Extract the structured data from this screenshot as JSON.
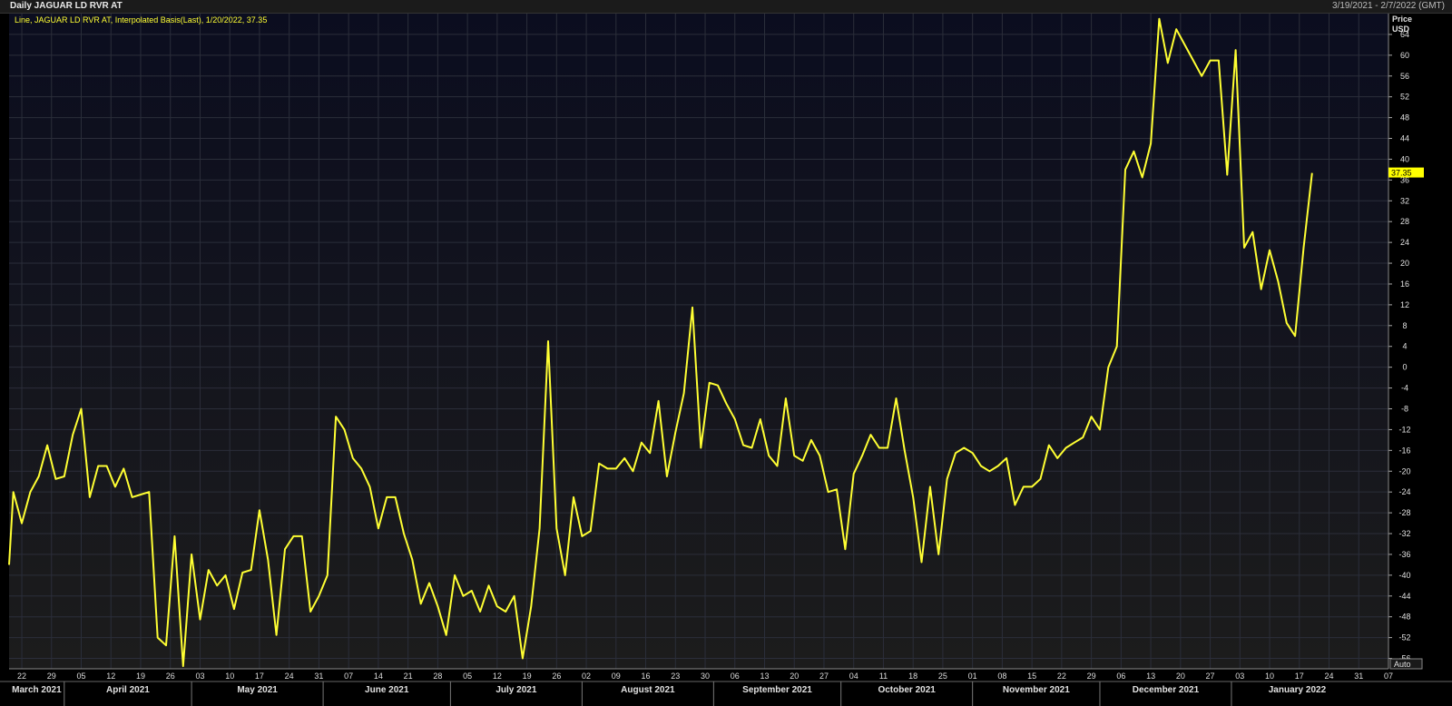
{
  "window": {
    "title": "Daily JAGUAR LD RVR AT",
    "date_range": "3/19/2021 - 2/7/2022 (GMT)",
    "legend": "Line, JAGUAR LD RVR AT, Interpolated Basis(Last),  1/20/2022, 37.35",
    "axis_unit_top": "Price",
    "axis_unit_bottom": "USD",
    "auto_button": "Auto",
    "last_value_label": "37.35"
  },
  "colors": {
    "background": "#0b0d1a",
    "line": "#ffff33",
    "grid": "#2b2e3a",
    "label_bg": "#ffff00"
  },
  "chart_data": {
    "type": "line",
    "title": "Daily JAGUAR LD RVR AT",
    "ylabel": "Price USD",
    "ylim": [
      -58,
      68
    ],
    "yticks": [
      -56,
      -52,
      -48,
      -44,
      -40,
      -36,
      -32,
      -28,
      -24,
      -20,
      -16,
      -12,
      -8,
      -4,
      0,
      4,
      8,
      12,
      16,
      20,
      24,
      28,
      32,
      36,
      40,
      44,
      48,
      52,
      56,
      60,
      64
    ],
    "xlim": [
      "2021-03-19",
      "2022-02-07"
    ],
    "xticks": [
      {
        "date": "2021-03-22",
        "label": "22"
      },
      {
        "date": "2021-03-29",
        "label": "29"
      },
      {
        "date": "2021-04-05",
        "label": "05"
      },
      {
        "date": "2021-04-12",
        "label": "12"
      },
      {
        "date": "2021-04-19",
        "label": "19"
      },
      {
        "date": "2021-04-26",
        "label": "26"
      },
      {
        "date": "2021-05-03",
        "label": "03"
      },
      {
        "date": "2021-05-10",
        "label": "10"
      },
      {
        "date": "2021-05-17",
        "label": "17"
      },
      {
        "date": "2021-05-24",
        "label": "24"
      },
      {
        "date": "2021-05-31",
        "label": "31"
      },
      {
        "date": "2021-06-07",
        "label": "07"
      },
      {
        "date": "2021-06-14",
        "label": "14"
      },
      {
        "date": "2021-06-21",
        "label": "21"
      },
      {
        "date": "2021-06-28",
        "label": "28"
      },
      {
        "date": "2021-07-05",
        "label": "05"
      },
      {
        "date": "2021-07-12",
        "label": "12"
      },
      {
        "date": "2021-07-19",
        "label": "19"
      },
      {
        "date": "2021-07-26",
        "label": "26"
      },
      {
        "date": "2021-08-02",
        "label": "02"
      },
      {
        "date": "2021-08-09",
        "label": "09"
      },
      {
        "date": "2021-08-16",
        "label": "16"
      },
      {
        "date": "2021-08-23",
        "label": "23"
      },
      {
        "date": "2021-08-30",
        "label": "30"
      },
      {
        "date": "2021-09-06",
        "label": "06"
      },
      {
        "date": "2021-09-13",
        "label": "13"
      },
      {
        "date": "2021-09-20",
        "label": "20"
      },
      {
        "date": "2021-09-27",
        "label": "27"
      },
      {
        "date": "2021-10-04",
        "label": "04"
      },
      {
        "date": "2021-10-11",
        "label": "11"
      },
      {
        "date": "2021-10-18",
        "label": "18"
      },
      {
        "date": "2021-10-25",
        "label": "25"
      },
      {
        "date": "2021-11-01",
        "label": "01"
      },
      {
        "date": "2021-11-08",
        "label": "08"
      },
      {
        "date": "2021-11-15",
        "label": "15"
      },
      {
        "date": "2021-11-22",
        "label": "22"
      },
      {
        "date": "2021-11-29",
        "label": "29"
      },
      {
        "date": "2021-12-06",
        "label": "06"
      },
      {
        "date": "2021-12-13",
        "label": "13"
      },
      {
        "date": "2021-12-20",
        "label": "20"
      },
      {
        "date": "2021-12-27",
        "label": "27"
      },
      {
        "date": "2022-01-03",
        "label": "03"
      },
      {
        "date": "2022-01-10",
        "label": "10"
      },
      {
        "date": "2022-01-17",
        "label": "17"
      },
      {
        "date": "2022-01-24",
        "label": "24"
      },
      {
        "date": "2022-01-31",
        "label": "31"
      },
      {
        "date": "2022-02-07",
        "label": "07"
      }
    ],
    "months": [
      {
        "label": "March 2021",
        "start": "2021-03-19",
        "end": "2021-04-01"
      },
      {
        "label": "April 2021",
        "start": "2021-04-01",
        "end": "2021-05-01"
      },
      {
        "label": "May 2021",
        "start": "2021-05-01",
        "end": "2021-06-01"
      },
      {
        "label": "June 2021",
        "start": "2021-06-01",
        "end": "2021-07-01"
      },
      {
        "label": "July 2021",
        "start": "2021-07-01",
        "end": "2021-08-01"
      },
      {
        "label": "August 2021",
        "start": "2021-08-01",
        "end": "2021-09-01"
      },
      {
        "label": "September 2021",
        "start": "2021-09-01",
        "end": "2021-10-01"
      },
      {
        "label": "October 2021",
        "start": "2021-10-01",
        "end": "2021-11-01"
      },
      {
        "label": "November 2021",
        "start": "2021-11-01",
        "end": "2021-12-01"
      },
      {
        "label": "December 2021",
        "start": "2021-12-01",
        "end": "2022-01-01"
      },
      {
        "label": "January 2022",
        "start": "2022-01-01",
        "end": "2022-02-01"
      }
    ],
    "series": [
      {
        "name": "JAGUAR LD RVR AT",
        "points": [
          [
            "2021-03-19",
            -38
          ],
          [
            "2021-03-20",
            -24
          ],
          [
            "2021-03-22",
            -30
          ],
          [
            "2021-03-24",
            -24
          ],
          [
            "2021-03-26",
            -21
          ],
          [
            "2021-03-28",
            -15
          ],
          [
            "2021-03-30",
            -21.5
          ],
          [
            "2021-04-01",
            -21
          ],
          [
            "2021-04-03",
            -13
          ],
          [
            "2021-04-05",
            -8
          ],
          [
            "2021-04-07",
            -25
          ],
          [
            "2021-04-09",
            -19
          ],
          [
            "2021-04-11",
            -19
          ],
          [
            "2021-04-13",
            -23
          ],
          [
            "2021-04-15",
            -19.5
          ],
          [
            "2021-04-17",
            -25
          ],
          [
            "2021-04-19",
            -24.5
          ],
          [
            "2021-04-21",
            -24
          ],
          [
            "2021-04-23",
            -52
          ],
          [
            "2021-04-25",
            -53.5
          ],
          [
            "2021-04-27",
            -32.5
          ],
          [
            "2021-04-29",
            -57.5
          ],
          [
            "2021-05-01",
            -36
          ],
          [
            "2021-05-03",
            -48.5
          ],
          [
            "2021-05-05",
            -39
          ],
          [
            "2021-05-07",
            -42
          ],
          [
            "2021-05-09",
            -40
          ],
          [
            "2021-05-11",
            -46.5
          ],
          [
            "2021-05-13",
            -39.5
          ],
          [
            "2021-05-15",
            -39
          ],
          [
            "2021-05-17",
            -27.5
          ],
          [
            "2021-05-19",
            -37
          ],
          [
            "2021-05-21",
            -51.5
          ],
          [
            "2021-05-23",
            -35
          ],
          [
            "2021-05-25",
            -32.5
          ],
          [
            "2021-05-27",
            -32.5
          ],
          [
            "2021-05-29",
            -47
          ],
          [
            "2021-05-31",
            -44
          ],
          [
            "2021-06-02",
            -40
          ],
          [
            "2021-06-04",
            -9.5
          ],
          [
            "2021-06-06",
            -12
          ],
          [
            "2021-06-08",
            -17.5
          ],
          [
            "2021-06-10",
            -19.5
          ],
          [
            "2021-06-12",
            -23
          ],
          [
            "2021-06-14",
            -31
          ],
          [
            "2021-06-16",
            -25
          ],
          [
            "2021-06-18",
            -25
          ],
          [
            "2021-06-20",
            -32
          ],
          [
            "2021-06-22",
            -37
          ],
          [
            "2021-06-24",
            -45.5
          ],
          [
            "2021-06-26",
            -41.5
          ],
          [
            "2021-06-28",
            -46
          ],
          [
            "2021-06-30",
            -51.5
          ],
          [
            "2021-07-02",
            -40
          ],
          [
            "2021-07-04",
            -44
          ],
          [
            "2021-07-06",
            -43
          ],
          [
            "2021-07-08",
            -47
          ],
          [
            "2021-07-10",
            -42
          ],
          [
            "2021-07-12",
            -46
          ],
          [
            "2021-07-14",
            -47
          ],
          [
            "2021-07-16",
            -44
          ],
          [
            "2021-07-18",
            -56
          ],
          [
            "2021-07-20",
            -46
          ],
          [
            "2021-07-22",
            -31
          ],
          [
            "2021-07-24",
            5
          ],
          [
            "2021-07-26",
            -31
          ],
          [
            "2021-07-28",
            -40
          ],
          [
            "2021-07-30",
            -25
          ],
          [
            "2021-08-01",
            -32.5
          ],
          [
            "2021-08-03",
            -31.5
          ],
          [
            "2021-08-05",
            -18.5
          ],
          [
            "2021-08-07",
            -19.5
          ],
          [
            "2021-08-09",
            -19.5
          ],
          [
            "2021-08-11",
            -17.5
          ],
          [
            "2021-08-13",
            -20
          ],
          [
            "2021-08-15",
            -14.5
          ],
          [
            "2021-08-17",
            -16.5
          ],
          [
            "2021-08-19",
            -6.5
          ],
          [
            "2021-08-21",
            -21
          ],
          [
            "2021-08-23",
            -12.5
          ],
          [
            "2021-08-25",
            -5
          ],
          [
            "2021-08-27",
            11.5
          ],
          [
            "2021-08-29",
            -15.5
          ],
          [
            "2021-08-31",
            -3
          ],
          [
            "2021-09-02",
            -3.5
          ],
          [
            "2021-09-04",
            -7
          ],
          [
            "2021-09-06",
            -10
          ],
          [
            "2021-09-08",
            -15
          ],
          [
            "2021-09-10",
            -15.5
          ],
          [
            "2021-09-12",
            -10
          ],
          [
            "2021-09-14",
            -17
          ],
          [
            "2021-09-16",
            -19
          ],
          [
            "2021-09-18",
            -6
          ],
          [
            "2021-09-20",
            -17
          ],
          [
            "2021-09-22",
            -18
          ],
          [
            "2021-09-24",
            -14
          ],
          [
            "2021-09-26",
            -17
          ],
          [
            "2021-09-28",
            -24
          ],
          [
            "2021-09-30",
            -23.5
          ],
          [
            "2021-10-02",
            -35
          ],
          [
            "2021-10-04",
            -20.5
          ],
          [
            "2021-10-06",
            -17
          ],
          [
            "2021-10-08",
            -13
          ],
          [
            "2021-10-10",
            -15.5
          ],
          [
            "2021-10-12",
            -15.5
          ],
          [
            "2021-10-14",
            -6
          ],
          [
            "2021-10-16",
            -16
          ],
          [
            "2021-10-18",
            -25
          ],
          [
            "2021-10-20",
            -37.5
          ],
          [
            "2021-10-22",
            -23
          ],
          [
            "2021-10-24",
            -36
          ],
          [
            "2021-10-26",
            -21.5
          ],
          [
            "2021-10-28",
            -16.5
          ],
          [
            "2021-10-30",
            -15.5
          ],
          [
            "2021-11-01",
            -16.5
          ],
          [
            "2021-11-03",
            -19
          ],
          [
            "2021-11-05",
            -20
          ],
          [
            "2021-11-07",
            -19
          ],
          [
            "2021-11-09",
            -17.5
          ],
          [
            "2021-11-11",
            -26.5
          ],
          [
            "2021-11-13",
            -23
          ],
          [
            "2021-11-15",
            -23
          ],
          [
            "2021-11-17",
            -21.5
          ],
          [
            "2021-11-19",
            -15
          ],
          [
            "2021-11-21",
            -17.5
          ],
          [
            "2021-11-23",
            -15.5
          ],
          [
            "2021-11-25",
            -14.5
          ],
          [
            "2021-11-27",
            -13.5
          ],
          [
            "2021-11-29",
            -9.5
          ],
          [
            "2021-12-01",
            -12
          ],
          [
            "2021-12-03",
            0
          ],
          [
            "2021-12-05",
            4
          ],
          [
            "2021-12-07",
            38
          ],
          [
            "2021-12-09",
            41.5
          ],
          [
            "2021-12-11",
            36.5
          ],
          [
            "2021-12-13",
            43
          ],
          [
            "2021-12-15",
            67
          ],
          [
            "2021-12-17",
            58.5
          ],
          [
            "2021-12-19",
            65
          ],
          [
            "2021-12-21",
            62
          ],
          [
            "2021-12-23",
            59
          ],
          [
            "2021-12-25",
            56
          ],
          [
            "2021-12-27",
            59
          ],
          [
            "2021-12-29",
            59
          ],
          [
            "2021-12-31",
            37
          ],
          [
            "2022-01-02",
            61
          ],
          [
            "2022-01-04",
            23
          ],
          [
            "2022-01-06",
            26
          ],
          [
            "2022-01-08",
            15
          ],
          [
            "2022-01-10",
            22.5
          ],
          [
            "2022-01-12",
            16.5
          ],
          [
            "2022-01-14",
            8.5
          ],
          [
            "2022-01-16",
            6
          ],
          [
            "2022-01-18",
            23
          ],
          [
            "2022-01-20",
            37.35
          ]
        ]
      }
    ]
  }
}
